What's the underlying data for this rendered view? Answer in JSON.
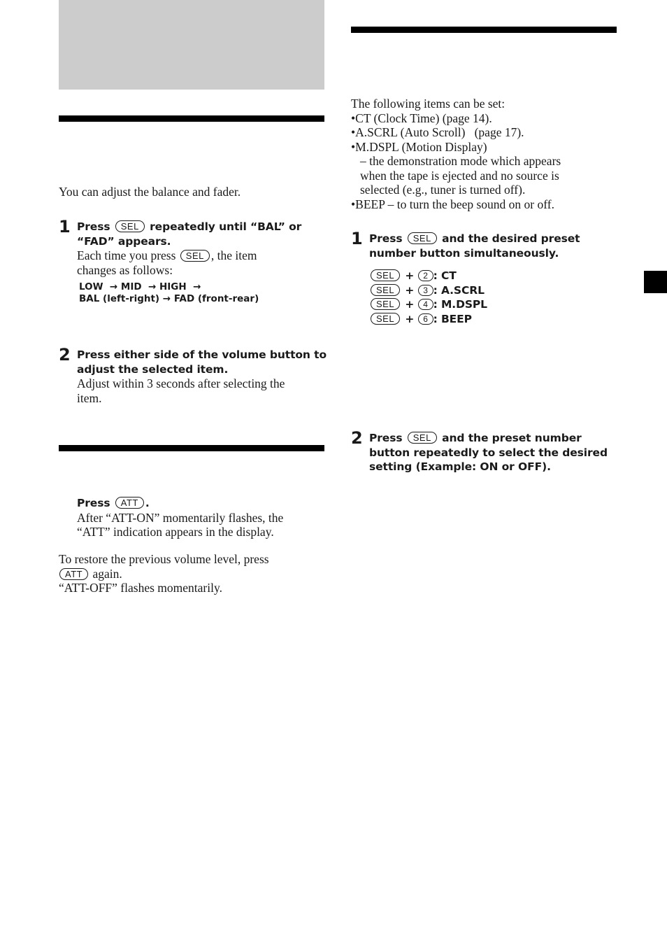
{
  "left_column": {
    "intro": "You can adjust the balance and fader.",
    "step1": {
      "number": "1",
      "press": "Press",
      "key": "SEL",
      "instruction_rest_1": "repeatedly until “BAL” or",
      "instruction_rest_2": "“FAD” appears.",
      "body_1_pre": "Each time you press",
      "body_key": "SEL",
      "body_1_post": ", the item",
      "body_2": "changes as follows:",
      "sequence_line_1": "LOW  → MID  → HIGH  →",
      "sequence_line_2": "BAL (left-right) → FAD (front-rear)"
    },
    "step2": {
      "number": "2",
      "instruction_1": "Press either side of the volume button to",
      "instruction_2": "adjust the selected item.",
      "body_1": "Adjust within 3 seconds after selecting the",
      "body_2": "item."
    },
    "att": {
      "press": "Press",
      "key": "ATT",
      "period": ".",
      "body_1": "After “ATT-ON” momentarily flashes, the",
      "body_2": "“ATT” indication appears in the display.",
      "restore_1": "To restore the previous volume level, press",
      "restore_key": "ATT",
      "restore_2": "again.",
      "restore_3": "“ATT-OFF” flashes momentarily."
    }
  },
  "right_column": {
    "intro": "The following items can be set:",
    "bullets": [
      "CT (Clock Time) (page 14).",
      "A.SCRL (Auto Scroll)   (page 17).",
      "M.DSPL (Motion Display)",
      "BEEP – to turn the beep sound on or off."
    ],
    "mdspl_desc": [
      "– the demonstration mode which appears",
      "when the tape is ejected and no source is",
      "selected (e.g., tuner is turned off)."
    ],
    "step1": {
      "number": "1",
      "press": "Press",
      "key": "SEL",
      "instruction_rest_1": "and the desired preset",
      "instruction_2": "number button simultaneously.",
      "combos": [
        {
          "key": "SEL",
          "plus": "+",
          "num": "2",
          "label": ": CT"
        },
        {
          "key": "SEL",
          "plus": "+",
          "num": "3",
          "label": ": A.SCRL"
        },
        {
          "key": "SEL",
          "plus": "+",
          "num": "4",
          "label": ": M.DSPL"
        },
        {
          "key": "SEL",
          "plus": "+",
          "num": "6",
          "label": ": BEEP"
        }
      ]
    },
    "step2": {
      "number": "2",
      "press": "Press",
      "key": "SEL",
      "instruction_rest_1": "and the preset number",
      "instruction_2": "button repeatedly to select the desired",
      "instruction_3": "setting (Example: ON or OFF)."
    }
  }
}
